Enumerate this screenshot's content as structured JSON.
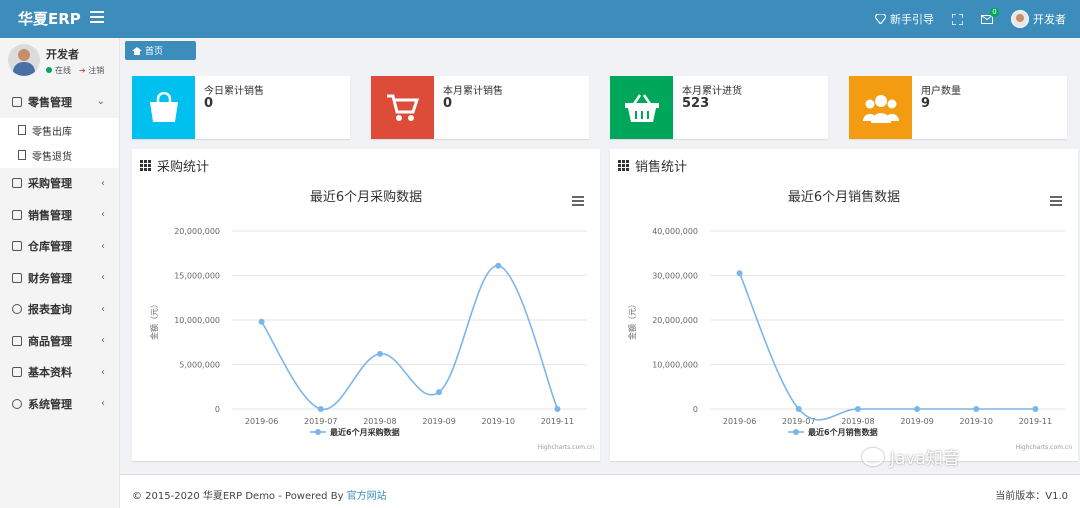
{
  "header": {
    "brand": "华夏ERP",
    "guide": "新手引导",
    "mail_badge": "0",
    "user": "开发者"
  },
  "user_panel": {
    "name": "开发者",
    "online": "在线",
    "logout": "注销"
  },
  "sidebar": {
    "items": [
      {
        "label": "零售管理",
        "arrow": "⌄",
        "open": true,
        "icon": "gift-icon"
      },
      {
        "label": "采购管理",
        "arrow": "‹",
        "icon": "monitor-icon"
      },
      {
        "label": "销售管理",
        "arrow": "‹",
        "icon": "briefcase-icon"
      },
      {
        "label": "仓库管理",
        "arrow": "‹",
        "icon": "layers-icon"
      },
      {
        "label": "财务管理",
        "arrow": "‹",
        "icon": "map-icon"
      },
      {
        "label": "报表查询",
        "arrow": "‹",
        "icon": "clock-icon"
      },
      {
        "label": "商品管理",
        "arrow": "‹",
        "icon": "dropbox-icon"
      },
      {
        "label": "基本资料",
        "arrow": "‹",
        "icon": "grid-icon"
      },
      {
        "label": "系统管理",
        "arrow": "‹",
        "icon": "gear-icon"
      }
    ],
    "subitems": [
      "零售出库",
      "零售退货"
    ]
  },
  "breadcrumb": {
    "home": "首页"
  },
  "info_boxes": [
    {
      "label": "今日累计销售",
      "value": "0",
      "color": "#00c0ef",
      "icon": "shopping-bag-icon"
    },
    {
      "label": "本月累计销售",
      "value": "0",
      "color": "#dd4b39",
      "icon": "shopping-cart-icon"
    },
    {
      "label": "本月累计进货",
      "value": "523",
      "color": "#00a65a",
      "icon": "basket-icon"
    },
    {
      "label": "用户数量",
      "value": "9",
      "color": "#f39c12",
      "icon": "users-icon"
    }
  ],
  "panels": {
    "purchase": "采购统计",
    "sales": "销售统计"
  },
  "chart_data": [
    {
      "type": "line",
      "title": "最近6个月采购数据",
      "ylabel": "金额（元）",
      "categories": [
        "2019-06",
        "2019-07",
        "2019-08",
        "2019-09",
        "2019-10",
        "2019-11"
      ],
      "yticks": [
        "0",
        "5,000,000",
        "10,000,000",
        "15,000,000",
        "20,000,000"
      ],
      "ylim": [
        0,
        20000000
      ],
      "series": [
        {
          "name": "最近6个月采购数据",
          "values": [
            9800000,
            0,
            6200000,
            1900000,
            16100000,
            0
          ]
        }
      ],
      "credits": "Highcharts.com.cn",
      "legend": "bottom-center",
      "grid": true,
      "color": "#7cb5ec"
    },
    {
      "type": "line",
      "title": "最近6个月销售数据",
      "ylabel": "金额（元）",
      "categories": [
        "2019-06",
        "2019-07",
        "2019-08",
        "2019-09",
        "2019-10",
        "2019-11"
      ],
      "yticks": [
        "0",
        "10,000,000",
        "20,000,000",
        "30,000,000",
        "40,000,000"
      ],
      "ylim": [
        0,
        40000000
      ],
      "series": [
        {
          "name": "最近6个月销售数据",
          "values": [
            30500000,
            0,
            0,
            0,
            0,
            0
          ]
        }
      ],
      "credits": "Highcharts.com.cn",
      "legend": "bottom-center",
      "grid": true,
      "color": "#7cb5ec"
    }
  ],
  "footer": {
    "copyright": "© 2015-2020 华夏ERP Demo - Powered By ",
    "link": "官方网站",
    "version": "当前版本：V1.0"
  },
  "watermark": "Java知音"
}
